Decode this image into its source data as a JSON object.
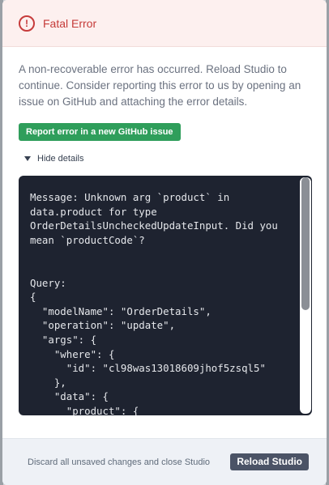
{
  "header": {
    "title": "Fatal Error",
    "icon": "alert-circle-icon",
    "accent_color": "#c53a38"
  },
  "body": {
    "description": "A non-recoverable error has occurred. Reload Studio to continue. Consider reporting this error to us by opening an issue on GitHub and attaching the error details.",
    "report_button_label": "Report error in a new GitHub issue",
    "details_toggle_label": "Hide details",
    "details_text": "Message: Unknown arg `product` in\ndata.product for type\nOrderDetailsUncheckedUpdateInput. Did you\nmean `productCode`?\n\n\nQuery:\n{\n  \"modelName\": \"OrderDetails\",\n  \"operation\": \"update\",\n  \"args\": {\n    \"where\": {\n      \"id\": \"cl98was13018609jhof5zsql5\"\n    },\n    \"data\": {\n      \"product\": {"
  },
  "footer": {
    "text": "Discard all unsaved changes and close Studio",
    "reload_button_label": "Reload Studio"
  }
}
